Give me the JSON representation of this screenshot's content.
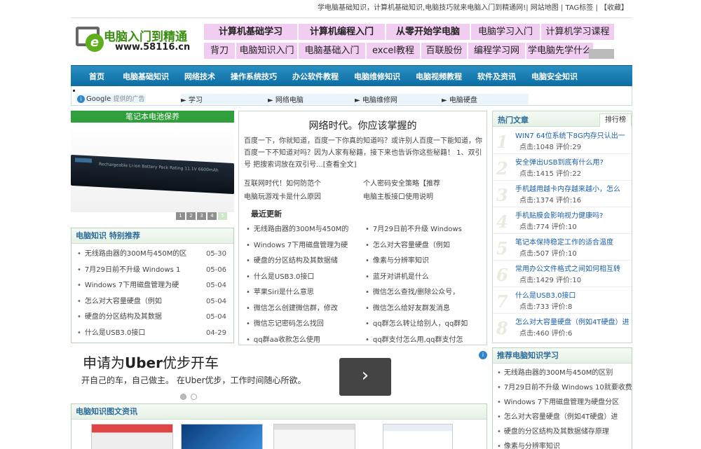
{
  "topbar": {
    "text": "学电脑基础知识，计算机基础知识,电脑技巧就来电脑入门到精通网!| 网站地图 | TAG标签 | 【收藏】"
  },
  "logo": {
    "title": "电脑入门到精通",
    "url": "www.58116.cn",
    "mark": "e"
  },
  "header_links": {
    "row1": [
      "计算机基础学习",
      "计算机编程入门",
      "从零开始学电脑",
      "电脑学习入门",
      "计算机学习课程"
    ],
    "row2": [
      "背刀",
      "电脑知识入门",
      "电脑基础入门",
      "excel教程",
      "百联股份",
      "编程学习网",
      "学电脑先学什么"
    ]
  },
  "nav": {
    "items": [
      "首页",
      "电脑基础知识",
      "网络技术",
      "操作系统技巧",
      "办公软件教程",
      "电脑维修知识",
      "电脑视频教程",
      "软件及资讯",
      "电脑安全知识"
    ]
  },
  "google_ad": {
    "brand": "Google",
    "label": "提供的广告",
    "links": [
      "► 学习",
      "► 网络电脑",
      "► 电脑维修网",
      "► 电脑硬盘"
    ]
  },
  "battery": {
    "title": "笔记本电池保养",
    "label": "Rechargeable Li-ion Battery Pack  Rating 11.1V 6600mAh",
    "pages": [
      "1",
      "2",
      "3",
      "4",
      "5"
    ]
  },
  "left_list": {
    "title": "电脑知识 特别推荐",
    "items": [
      {
        "t": "无线路由器的300M与450M的区",
        "d": "05-30"
      },
      {
        "t": "7月29日前不升级 Windows 1",
        "d": "05-06"
      },
      {
        "t": "Windows 7下用磁盘管理为硬",
        "d": "05-04"
      },
      {
        "t": "怎么对大容量硬盘（例如",
        "d": "05-04"
      },
      {
        "t": "硬盘的分区结构及其数据",
        "d": "05-04"
      },
      {
        "t": "什么是USB3.0接口",
        "d": "04-29"
      }
    ]
  },
  "center": {
    "title": "网络时代。你应该掌握的",
    "para": "百度一下，你就知道，百度一下你真的知道吗？或许别人百度一下能知道，你百度一下不知道对吗？因为人家有秘籍，接下来也告诉你这些秘籍！ 1、双引号 把搜索词放在双引号...[查看全文]",
    "links": [
      [
        "互联网时代！如何防范个",
        "个人密码安全策略【推荐"
      ],
      [
        "电脑玩游戏卡是什么原因",
        "电脑主板接口使用说明"
      ]
    ],
    "new_title": "最近更新",
    "list": [
      [
        "无线路由器的300M与450M的",
        "7月29日前不升级 Windows"
      ],
      [
        "Windows 7下用磁盘管理为硬",
        "怎么对大容量硬盘（例如"
      ],
      [
        "硬盘的分区结构及其数据储",
        "像素与分辨率知识"
      ],
      [
        "什么是USB3.0接口",
        "蓝牙对讲机是什么"
      ],
      [
        "苹果Siri是什么意思",
        "微信怎么查找/删除公众号，"
      ],
      [
        "微信怎么创建微信群，修改",
        "微信怎么给好友群发消息"
      ],
      [
        "微信忘记密码怎么找回",
        "qq群怎么转让给别人，qq群如"
      ],
      [
        "qq群aa收款怎么使用",
        "qq群支付怎么用,qq群支付怎"
      ]
    ]
  },
  "hot": {
    "title": "热门文章",
    "tab": "排行榜",
    "items": [
      {
        "n": "1",
        "t": "WIN7 64位系统下8G内存只认出一",
        "s": "点击:1048  评价:29"
      },
      {
        "n": "2",
        "t": "安全弹出USB到底有什么用?",
        "s": "点击:1415  评价:22"
      },
      {
        "n": "3",
        "t": "手机越用越卡内存越来越小，怎么",
        "s": "点击:1374  评价:16"
      },
      {
        "n": "4",
        "t": "手机贴膜会影响视力健康吗?",
        "s": "点击:774  评价:10"
      },
      {
        "n": "5",
        "t": "笔记本保持稳定工作的适合温度",
        "s": "点击:507  评价:10"
      },
      {
        "n": "6",
        "t": "常用办公文件格式之间如何相互转",
        "s": "点击:1429  评价:10"
      },
      {
        "n": "7",
        "t": "什么是USB3.0接口",
        "s": "点击:733  评价:8"
      },
      {
        "n": "8",
        "t": "怎么对大容量硬盘（例如4T硬盘）进",
        "s": "点击:460  评价:6"
      }
    ]
  },
  "ad": {
    "title_pre": "申请为",
    "title_brand": "Uber",
    "title_post": "优步开车",
    "sub": "开自己的车，自己做主。 在Uber优步，工作时间随心所欲。",
    "arrow": "›",
    "info": "i"
  },
  "photo_news": {
    "title": "电脑知识图文资讯"
  },
  "recommend": {
    "title": "推荐电脑知识学习",
    "items": [
      "无线路由器的300M与450M的区别",
      "7月29日前不升级 Windows 10就要收费",
      "Windows 7下用磁盘管理为硬盘分区",
      "怎么对大容量硬盘（例如4T硬盘）进",
      "硬盘的分区结构及其数据储存原理",
      "像素与分辨率知识"
    ]
  },
  "colors": {
    "nav": "#1a7db5",
    "green": "#2e9f3a",
    "pink": "#f2cdf2",
    "link": "#1a5fa5"
  }
}
